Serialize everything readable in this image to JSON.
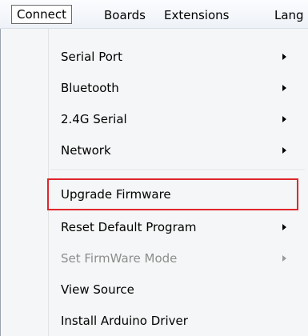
{
  "menubar": {
    "items": [
      {
        "label": "Connect",
        "active": true
      },
      {
        "label": "Boards"
      },
      {
        "label": "Extensions"
      },
      {
        "label": "Lang"
      }
    ]
  },
  "dropdown": {
    "items": [
      {
        "label": "Serial Port",
        "submenu": true
      },
      {
        "label": "Bluetooth",
        "submenu": true
      },
      {
        "label": "2.4G Serial",
        "submenu": true
      },
      {
        "label": "Network",
        "submenu": true
      },
      {
        "label": "Upgrade Firmware",
        "submenu": false,
        "highlighted": true
      },
      {
        "label": "Reset Default Program",
        "submenu": true
      },
      {
        "label": "Set FirmWare Mode",
        "submenu": true,
        "disabled": true
      },
      {
        "label": "View Source",
        "submenu": false
      },
      {
        "label": "Install Arduino Driver",
        "submenu": false
      }
    ]
  },
  "colors": {
    "highlight_border": "#e0262b",
    "menu_background": "#f5f6f7",
    "disabled_text": "#8d8d8d"
  }
}
